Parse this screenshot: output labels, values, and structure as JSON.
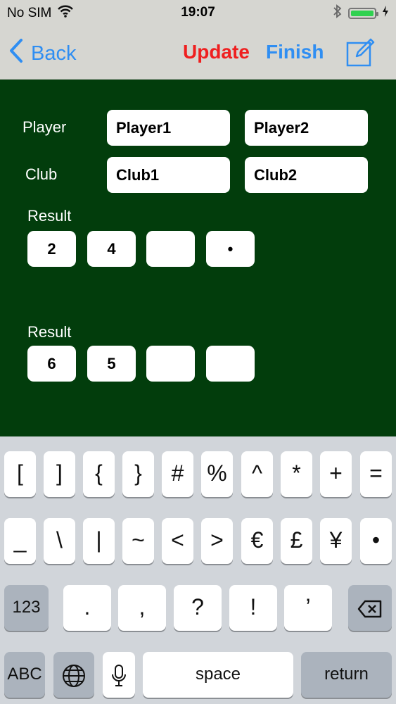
{
  "status_bar": {
    "carrier": "No SIM",
    "time": "19:07",
    "battery_level_percent": 100
  },
  "nav": {
    "back_label": "Back",
    "update_label": "Update",
    "finish_label": "Finish",
    "compose_icon": "compose-icon"
  },
  "form": {
    "player_label": "Player",
    "club_label": "Club",
    "player1": "Player1",
    "player2": "Player2",
    "club1": "Club1",
    "club2": "Club2",
    "result1_label": "Result",
    "result1": [
      "2",
      "4",
      "",
      "•"
    ],
    "result2_label": "Result",
    "result2": [
      "6",
      "5",
      "",
      ""
    ]
  },
  "keyboard": {
    "row1": [
      "[",
      "]",
      "{",
      "}",
      "#",
      "%",
      "^",
      "*",
      "+",
      "="
    ],
    "row2": [
      "_",
      "\\",
      "|",
      "~",
      "<",
      ">",
      "€",
      "£",
      "¥",
      "•"
    ],
    "row3": [
      "123",
      ".",
      ",",
      "?",
      "!",
      "’",
      "delete-icon"
    ],
    "row4": [
      "ABC",
      "globe-icon",
      "microphone-icon",
      "space",
      "return"
    ]
  },
  "colors": {
    "accent_blue": "#2f8ef2",
    "update_red": "#ef1f1f",
    "board_green": "#023d0c",
    "keyboard_bg": "#d1d5da"
  }
}
